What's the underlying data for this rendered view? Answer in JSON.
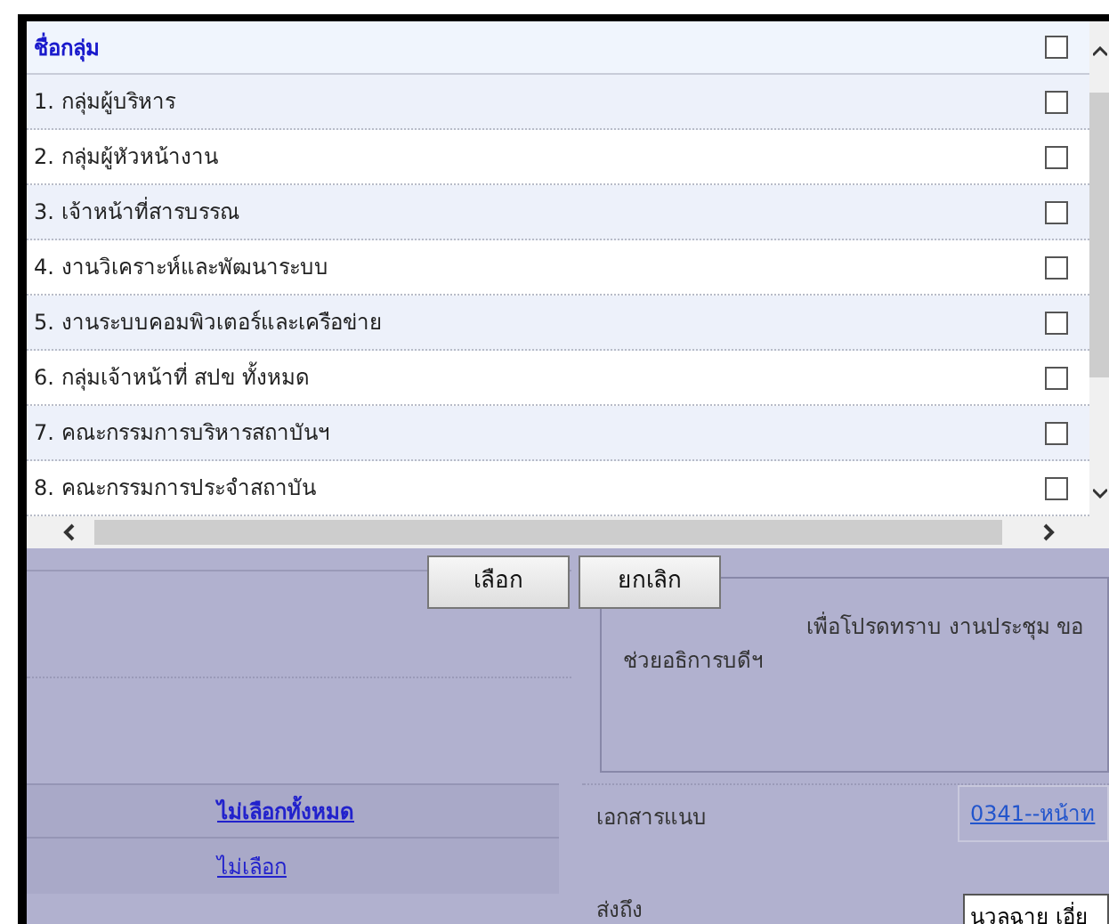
{
  "dialog": {
    "header": {
      "label": "ชื่อกลุ่ม",
      "checked": false
    },
    "groups": [
      {
        "label": "1. กลุ่มผู้บริหาร",
        "checked": false
      },
      {
        "label": "2. กลุ่มผู้หัวหน้างาน",
        "checked": false
      },
      {
        "label": "3. เจ้าหน้าที่สารบรรณ",
        "checked": false
      },
      {
        "label": "4. งานวิเคราะห์และพัฒนาระบบ",
        "checked": false
      },
      {
        "label": "5. งานระบบคอมพิวเตอร์และเครือข่าย",
        "checked": false
      },
      {
        "label": "6. กลุ่มเจ้าหน้าที่ สปข ทั้งหมด",
        "checked": false
      },
      {
        "label": "7. คณะกรรมการบริหารสถาบันฯ",
        "checked": false
      },
      {
        "label": "8. คณะกรรมการประจำสถาบัน",
        "checked": false
      }
    ],
    "buttons": [
      "เลือก",
      "ยกเลิก"
    ]
  },
  "form": {
    "message_lines": [
      "เพื่อโปรดทราบ งานประชุม ขอ",
      "ช่วยอธิการบดีฯ"
    ],
    "links": [
      "ไม่เลือกทั้งหมด",
      "ไม่เลือก"
    ],
    "attachment_label": "เอกสารแนบ",
    "attachment": "0341--หน้าท",
    "send_to_label": "ส่งถึง",
    "send_to": "นวลฉาย เอี่ย"
  }
}
